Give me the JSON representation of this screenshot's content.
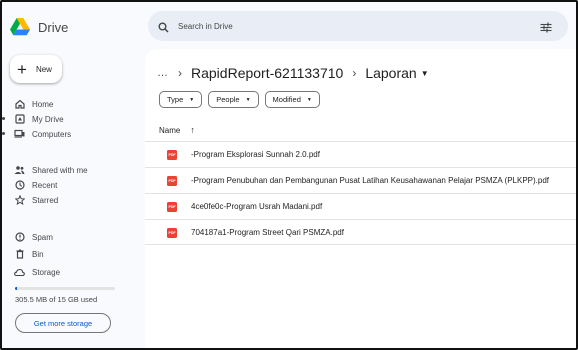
{
  "app": {
    "name": "Drive"
  },
  "new_button": {
    "label": "New"
  },
  "sidebar": {
    "items": [
      {
        "label": "Home",
        "icon": "home-icon"
      },
      {
        "label": "My Drive",
        "icon": "my-drive-icon"
      },
      {
        "label": "Computers",
        "icon": "computers-icon"
      },
      {
        "label": "Shared with me",
        "icon": "shared-icon"
      },
      {
        "label": "Recent",
        "icon": "recent-icon"
      },
      {
        "label": "Starred",
        "icon": "star-icon"
      },
      {
        "label": "Spam",
        "icon": "spam-icon"
      },
      {
        "label": "Bin",
        "icon": "bin-icon"
      },
      {
        "label": "Storage",
        "icon": "cloud-icon"
      }
    ],
    "storage_used_fraction": 0.02,
    "storage_text": "305.5 MB of 15 GB used",
    "get_storage_label": "Get more storage"
  },
  "search": {
    "placeholder": "Search in Drive"
  },
  "breadcrumb": {
    "ellipsis": "…",
    "sep1": "›",
    "sep2": "›",
    "item1": "RapidReport-621133710",
    "item2": "Laporan"
  },
  "filters": {
    "type": "Type",
    "people": "People",
    "modified": "Modified"
  },
  "list": {
    "name_header": "Name",
    "sort_arrow": "↑",
    "files": [
      {
        "name": "-Program Eksplorasi Sunnah 2.0.pdf"
      },
      {
        "name": "-Program Penubuhan dan Pembangunan Pusat Latihan Keusahawanan Pelajar PSMZA (PLKPP).pdf"
      },
      {
        "name": "4ce0fe0c-Program Usrah Madani.pdf"
      },
      {
        "name": "704187a1-Program Street Qari PSMZA.pdf"
      }
    ]
  },
  "colors": {
    "accent": "#0b57d0",
    "pdf": "#ea4335",
    "background": "#f8fafd"
  }
}
